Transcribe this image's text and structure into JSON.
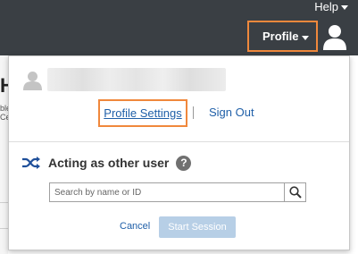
{
  "header": {
    "help_label": "Help",
    "profile_label": "Profile"
  },
  "background": {
    "heading_fragment": "H",
    "text_fragment_1": "ble",
    "text_fragment_2": "Ce"
  },
  "menu": {
    "profile_settings_label": "Profile Settings",
    "sign_out_label": "Sign Out"
  },
  "acting": {
    "title": "Acting as other user",
    "help_glyph": "?",
    "search_placeholder": "Search by name or ID",
    "cancel_label": "Cancel",
    "start_label": "Start Session"
  },
  "colors": {
    "header_bg": "#3a3f44",
    "highlight": "#f0883c",
    "link": "#1f5fa8",
    "disabled_button": "#b7cfe6"
  },
  "icons": {
    "header_avatar": "user-avatar-icon",
    "panel_avatar": "user-avatar-icon",
    "acting": "shuffle-icon",
    "help": "help-icon",
    "search": "search-icon"
  }
}
